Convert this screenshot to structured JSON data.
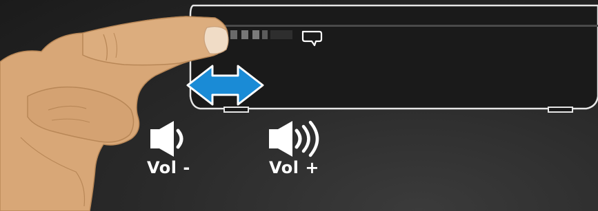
{
  "labels": {
    "volume_down": "Vol -",
    "volume_up": "Vol +"
  },
  "icons": {
    "volume_down": "speaker-low-icon",
    "volume_up": "speaker-high-icon",
    "gesture_arrow": "double-arrow-horizontal-icon",
    "device_indicator": "speech-bubble-icon"
  },
  "colors": {
    "background": "#242424",
    "device_body": "#1a1a1a",
    "device_outline": "#e6e6e6",
    "arrow_fill": "#1a8bd6",
    "skin": "#d9a877",
    "text": "#ffffff"
  }
}
